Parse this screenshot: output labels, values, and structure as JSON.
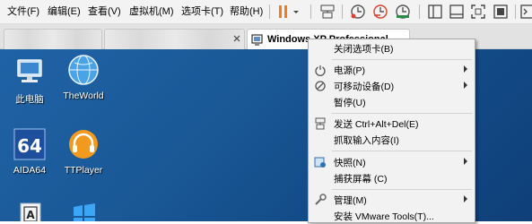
{
  "menubar": {
    "file": "文件(F)",
    "edit": "编辑(E)",
    "view": "查看(V)",
    "vm": "虚拟机(M)",
    "tabs": "选项卡(T)",
    "help": "帮助(H)"
  },
  "colors": {
    "pause_orange": "#f07d1a",
    "desktop_blue": "#1a5896",
    "snapshot_red": "#d9412b"
  },
  "tabs": {
    "active_label": "Windows XP Professional"
  },
  "desktop": {
    "icons": [
      {
        "label": "此电脑",
        "icon": "computer-icon"
      },
      {
        "label": "TheWorld",
        "icon": "theworld-globe-icon"
      },
      {
        "label": "AIDA64",
        "icon": "aida64-icon"
      },
      {
        "label": "TTPlayer",
        "icon": "ttplayer-headphones-icon"
      },
      {
        "label": "A",
        "icon": "document-a-icon"
      },
      {
        "label": "",
        "icon": "windows-logo-icon"
      }
    ]
  },
  "context_menu": {
    "items": [
      {
        "label": "关闭选项卡(B)",
        "icon": "",
        "submenu": false
      },
      {
        "label": "电源(P)",
        "icon": "power-icon",
        "submenu": true
      },
      {
        "label": "可移动设备(D)",
        "icon": "removable-device-icon",
        "submenu": true
      },
      {
        "label": "暂停(U)",
        "icon": "",
        "submenu": false
      },
      {
        "label": "发送 Ctrl+Alt+Del(E)",
        "icon": "send-keys-icon",
        "submenu": false
      },
      {
        "label": "抓取输入内容(I)",
        "icon": "",
        "submenu": false
      },
      {
        "label": "快照(N)",
        "icon": "snapshot-icon",
        "submenu": true
      },
      {
        "label": "捕获屏幕 (C)",
        "icon": "",
        "submenu": false
      },
      {
        "label": "管理(M)",
        "icon": "wrench-icon",
        "submenu": true
      },
      {
        "label": "安装 VMware Tools(T)...",
        "icon": "",
        "submenu": false
      }
    ]
  }
}
